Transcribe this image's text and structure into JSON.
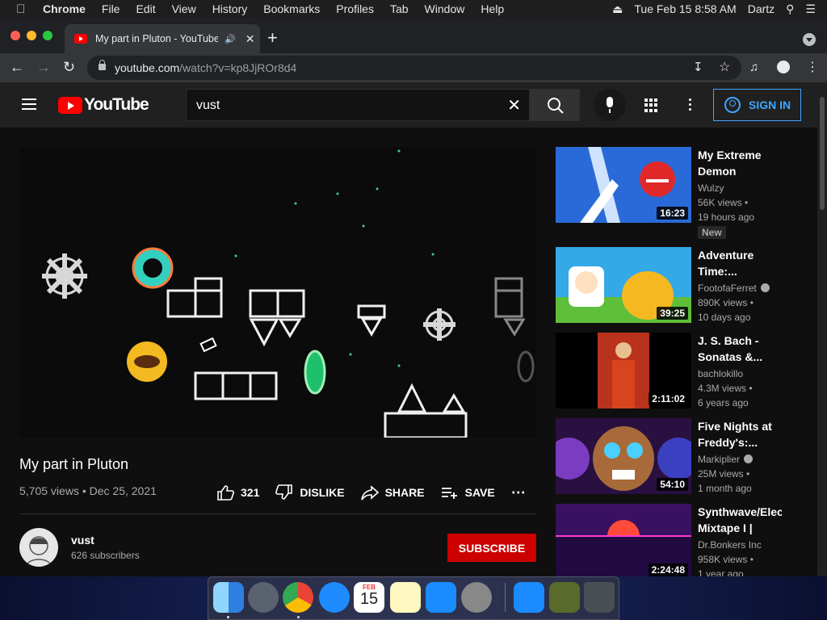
{
  "menubar": {
    "app": "Chrome",
    "items": [
      "File",
      "Edit",
      "View",
      "History",
      "Bookmarks",
      "Profiles",
      "Tab",
      "Window",
      "Help"
    ],
    "datetime": "Tue Feb 15  8:58 AM",
    "user": "Dartz"
  },
  "browser": {
    "tab_title": "My part in Pluton - YouTube",
    "url_host": "youtube.com",
    "url_path": "/watch?v=kp8JjROr8d4"
  },
  "youtube": {
    "logo_text": "YouTube",
    "search_value": "vust",
    "sign_in": "SIGN IN"
  },
  "video": {
    "title": "My part in Pluton",
    "views": "5,705 views",
    "date": "Dec 25, 2021",
    "likes": "321",
    "dislike_label": "DISLIKE",
    "share_label": "SHARE",
    "save_label": "SAVE"
  },
  "channel": {
    "name": "vust",
    "subscribers": "626 subscribers",
    "subscribe_label": "SUBSCRIBE"
  },
  "related": [
    {
      "title": "My Extreme Demon Layou...",
      "channel": "Wulzy",
      "views": "56K views •",
      "age": "19 hours ago",
      "duration": "16:23",
      "badge": "New",
      "verified": false
    },
    {
      "title": "Adventure Time:...",
      "channel": "FootofaFerret",
      "views": "890K views •",
      "age": "10 days ago",
      "duration": "39:25",
      "verified": true
    },
    {
      "title": "J. S. Bach - Sonatas &...",
      "channel": "bachlokillo",
      "views": "4.3M views •",
      "age": "6 years ago",
      "duration": "2:11:02",
      "verified": false
    },
    {
      "title": "Five Nights at Freddy's:...",
      "channel": "Markiplier",
      "views": "25M views •",
      "age": "1 month ago",
      "duration": "54:10",
      "verified": true
    },
    {
      "title": "Synthwave/Elec Mixtape I | For...",
      "channel": "Dr.Bonkers Inc",
      "views": "958K views •",
      "age": "1 year ago",
      "duration": "2:24:48",
      "verified": false
    }
  ],
  "dock": {
    "calendar_month": "FEB",
    "calendar_day": "15"
  }
}
